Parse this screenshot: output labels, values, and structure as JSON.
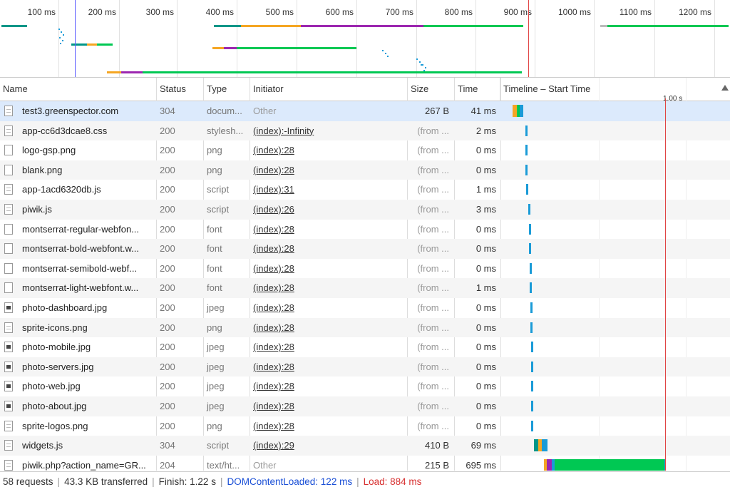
{
  "overview": {
    "ticks": [
      "100 ms",
      "200 ms",
      "300 ms",
      "400 ms",
      "500 ms",
      "600 ms",
      "700 ms",
      "800 ms",
      "900 ms",
      "1000 ms",
      "1100 ms",
      "1200 ms"
    ]
  },
  "columns": {
    "name": "Name",
    "status": "Status",
    "type": "Type",
    "initiator": "Initiator",
    "size": "Size",
    "time": "Time",
    "timeline": "Timeline – Start Time",
    "timeline_marker": "1.00 s"
  },
  "rows": [
    {
      "name": "test3.greenspector.com",
      "status": "304",
      "type": "docum...",
      "initiator": "Other",
      "size": "267 B",
      "time": "41 ms"
    },
    {
      "name": "app-cc6d3dcae8.css",
      "status": "200",
      "type": "stylesh...",
      "initiator": "(index):-Infinity",
      "size": "(from ...",
      "time": "2 ms"
    },
    {
      "name": "logo-gsp.png",
      "status": "200",
      "type": "png",
      "initiator": "(index):28",
      "size": "(from ...",
      "time": "0 ms"
    },
    {
      "name": "blank.png",
      "status": "200",
      "type": "png",
      "initiator": "(index):28",
      "size": "(from ...",
      "time": "0 ms"
    },
    {
      "name": "app-1acd6320db.js",
      "status": "200",
      "type": "script",
      "initiator": "(index):31",
      "size": "(from ...",
      "time": "1 ms"
    },
    {
      "name": "piwik.js",
      "status": "200",
      "type": "script",
      "initiator": "(index):26",
      "size": "(from ...",
      "time": "3 ms"
    },
    {
      "name": "montserrat-regular-webfon...",
      "status": "200",
      "type": "font",
      "initiator": "(index):28",
      "size": "(from ...",
      "time": "0 ms"
    },
    {
      "name": "montserrat-bold-webfont.w...",
      "status": "200",
      "type": "font",
      "initiator": "(index):28",
      "size": "(from ...",
      "time": "0 ms"
    },
    {
      "name": "montserrat-semibold-webf...",
      "status": "200",
      "type": "font",
      "initiator": "(index):28",
      "size": "(from ...",
      "time": "0 ms"
    },
    {
      "name": "montserrat-light-webfont.w...",
      "status": "200",
      "type": "font",
      "initiator": "(index):28",
      "size": "(from ...",
      "time": "1 ms"
    },
    {
      "name": "photo-dashboard.jpg",
      "status": "200",
      "type": "jpeg",
      "initiator": "(index):28",
      "size": "(from ...",
      "time": "0 ms"
    },
    {
      "name": "sprite-icons.png",
      "status": "200",
      "type": "png",
      "initiator": "(index):28",
      "size": "(from ...",
      "time": "0 ms"
    },
    {
      "name": "photo-mobile.jpg",
      "status": "200",
      "type": "jpeg",
      "initiator": "(index):28",
      "size": "(from ...",
      "time": "0 ms"
    },
    {
      "name": "photo-servers.jpg",
      "status": "200",
      "type": "jpeg",
      "initiator": "(index):28",
      "size": "(from ...",
      "time": "0 ms"
    },
    {
      "name": "photo-web.jpg",
      "status": "200",
      "type": "jpeg",
      "initiator": "(index):28",
      "size": "(from ...",
      "time": "0 ms"
    },
    {
      "name": "photo-about.jpg",
      "status": "200",
      "type": "jpeg",
      "initiator": "(index):28",
      "size": "(from ...",
      "time": "0 ms"
    },
    {
      "name": "sprite-logos.png",
      "status": "200",
      "type": "png",
      "initiator": "(index):28",
      "size": "(from ...",
      "time": "0 ms"
    },
    {
      "name": "widgets.js",
      "status": "304",
      "type": "script",
      "initiator": "(index):29",
      "size": "410 B",
      "time": "69 ms"
    },
    {
      "name": "piwik.php?action_name=GR...",
      "status": "204",
      "type": "text/ht...",
      "initiator": "Other",
      "size": "215 B",
      "time": "695 ms"
    }
  ],
  "statusbar": {
    "requests": "58 requests",
    "transferred": "43.3 KB transferred",
    "finish": "Finish: 1.22 s",
    "dcl": "DOMContentLoaded: 122 ms",
    "load": "Load: 884 ms"
  },
  "colors": {
    "waiting": "#00c853",
    "connect": "#f5a623",
    "ssl": "#9c27b0",
    "dns": "#009688",
    "download": "#1a9bd7",
    "load_marker": "#e04444",
    "dcl_marker": "#5b5bff"
  }
}
